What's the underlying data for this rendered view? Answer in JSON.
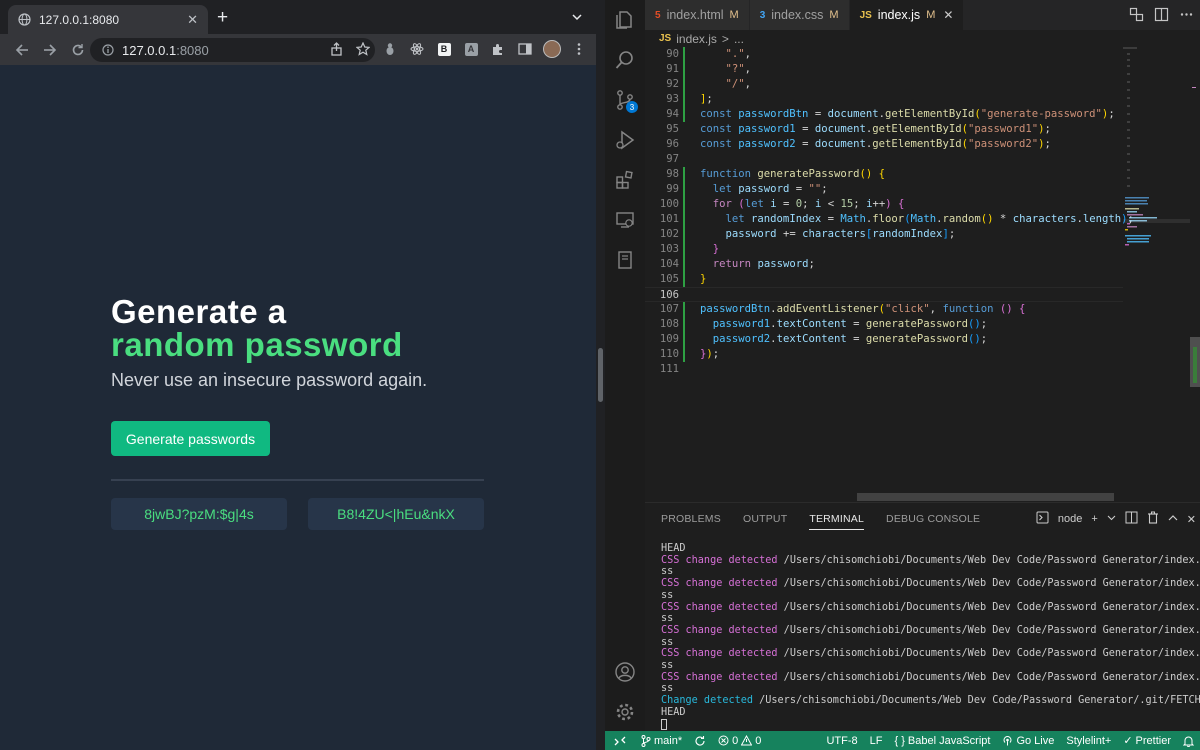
{
  "browser": {
    "tab_title": "127.0.0.1:8080",
    "url_host": "127.0.0.1",
    "url_port": ":8080",
    "ext_b": "B",
    "ext_a": "A"
  },
  "app": {
    "heading_line1": "Generate a",
    "heading_line2": "random password",
    "subtitle": "Never use an insecure password again.",
    "button_label": "Generate passwords",
    "password1": "8jwBJ?pzM:$g|4s",
    "password2": "B8!4ZU<|hEu&nkX",
    "accent_color": "#4ade80",
    "button_color": "#10b981",
    "background_color": "#1f2937"
  },
  "editor": {
    "tabs": [
      {
        "icon": "5",
        "name": "index.html",
        "status": "M"
      },
      {
        "icon": "3",
        "name": "index.css",
        "status": "M"
      },
      {
        "icon": "JS",
        "name": "index.js",
        "status": "M"
      }
    ],
    "breadcrumb_icon": "JS",
    "breadcrumb_file": "index.js",
    "breadcrumb_sep": ">",
    "breadcrumb_more": "...",
    "scm_badge": "3",
    "line_numbers": [
      "90",
      "91",
      "92",
      "93",
      "94",
      "95",
      "96",
      "97",
      "98",
      "99",
      "100",
      "101",
      "102",
      "103",
      "104",
      "105",
      "106",
      "107",
      "108",
      "109",
      "110",
      "111"
    ]
  },
  "panel": {
    "tabs": [
      "PROBLEMS",
      "OUTPUT",
      "TERMINAL",
      "DEBUG CONSOLE"
    ],
    "terminal_name": "node",
    "lines": [
      {
        "a": "HEAD"
      },
      {
        "k": "CSS change detected",
        "p": " /Users/chisomchiobi/Documents/Web Dev Code/Password Generator/index.c"
      },
      {
        "a": "ss"
      },
      {
        "k": "CSS change detected",
        "p": " /Users/chisomchiobi/Documents/Web Dev Code/Password Generator/index.c"
      },
      {
        "a": "ss"
      },
      {
        "k": "CSS change detected",
        "p": " /Users/chisomchiobi/Documents/Web Dev Code/Password Generator/index.c"
      },
      {
        "a": "ss"
      },
      {
        "k": "CSS change detected",
        "p": " /Users/chisomchiobi/Documents/Web Dev Code/Password Generator/index.c"
      },
      {
        "a": "ss"
      },
      {
        "k": "CSS change detected",
        "p": " /Users/chisomchiobi/Documents/Web Dev Code/Password Generator/index.c"
      },
      {
        "a": "ss"
      },
      {
        "k": "CSS change detected",
        "p": " /Users/chisomchiobi/Documents/Web Dev Code/Password Generator/index.c"
      },
      {
        "a": "ss"
      },
      {
        "c": "Change detected",
        "p": " /Users/chisomchiobi/Documents/Web Dev Code/Password Generator/.git/FETCH_"
      },
      {
        "a": "HEAD"
      }
    ]
  },
  "status": {
    "branch": "main*",
    "errors": "0",
    "warnings": "0",
    "encoding": "UTF-8",
    "eol": "LF",
    "language": "Babel JavaScript",
    "golive": "Go Live",
    "stylelint": "Stylelint+",
    "prettier": "Prettier",
    "color": "#16825d"
  }
}
